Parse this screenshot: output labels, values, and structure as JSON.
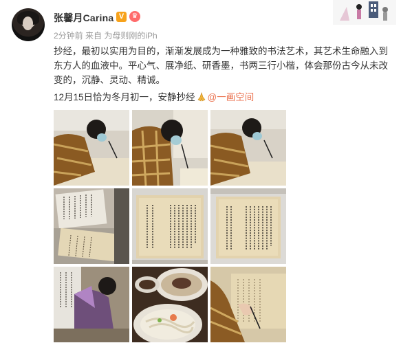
{
  "user": {
    "name": "张馨月Carina",
    "vip_badge": "V",
    "crown_badge": "♛"
  },
  "meta": {
    "time": "2分钟前",
    "source_prefix": "来自",
    "device": "为母则刚的iPh"
  },
  "post": {
    "text": "抄经，最初以实用为目的，渐渐发展成为一种雅致的书法艺术，其艺术生命融入到东方人的血液中。平心气、展净纸、研香墨，书两三行小楷，体会那份古今从未改变的，沉静、灵动、精诚。",
    "date_text": "12月15日恰为冬月初一，安静抄经",
    "mention": "@一画空间"
  },
  "photos": [
    {
      "alt": "photo-1",
      "kind": "writing"
    },
    {
      "alt": "photo-2",
      "kind": "writing-close"
    },
    {
      "alt": "photo-3",
      "kind": "writing"
    },
    {
      "alt": "photo-4",
      "kind": "scroll-desk"
    },
    {
      "alt": "photo-5",
      "kind": "scroll"
    },
    {
      "alt": "photo-6",
      "kind": "scroll"
    },
    {
      "alt": "photo-7",
      "kind": "standing"
    },
    {
      "alt": "photo-8",
      "kind": "food"
    },
    {
      "alt": "photo-9",
      "kind": "writing-close"
    }
  ],
  "colors": {
    "mention": "#eb7350",
    "vip": "#f7a21b",
    "text": "#333333",
    "meta": "#999999"
  }
}
